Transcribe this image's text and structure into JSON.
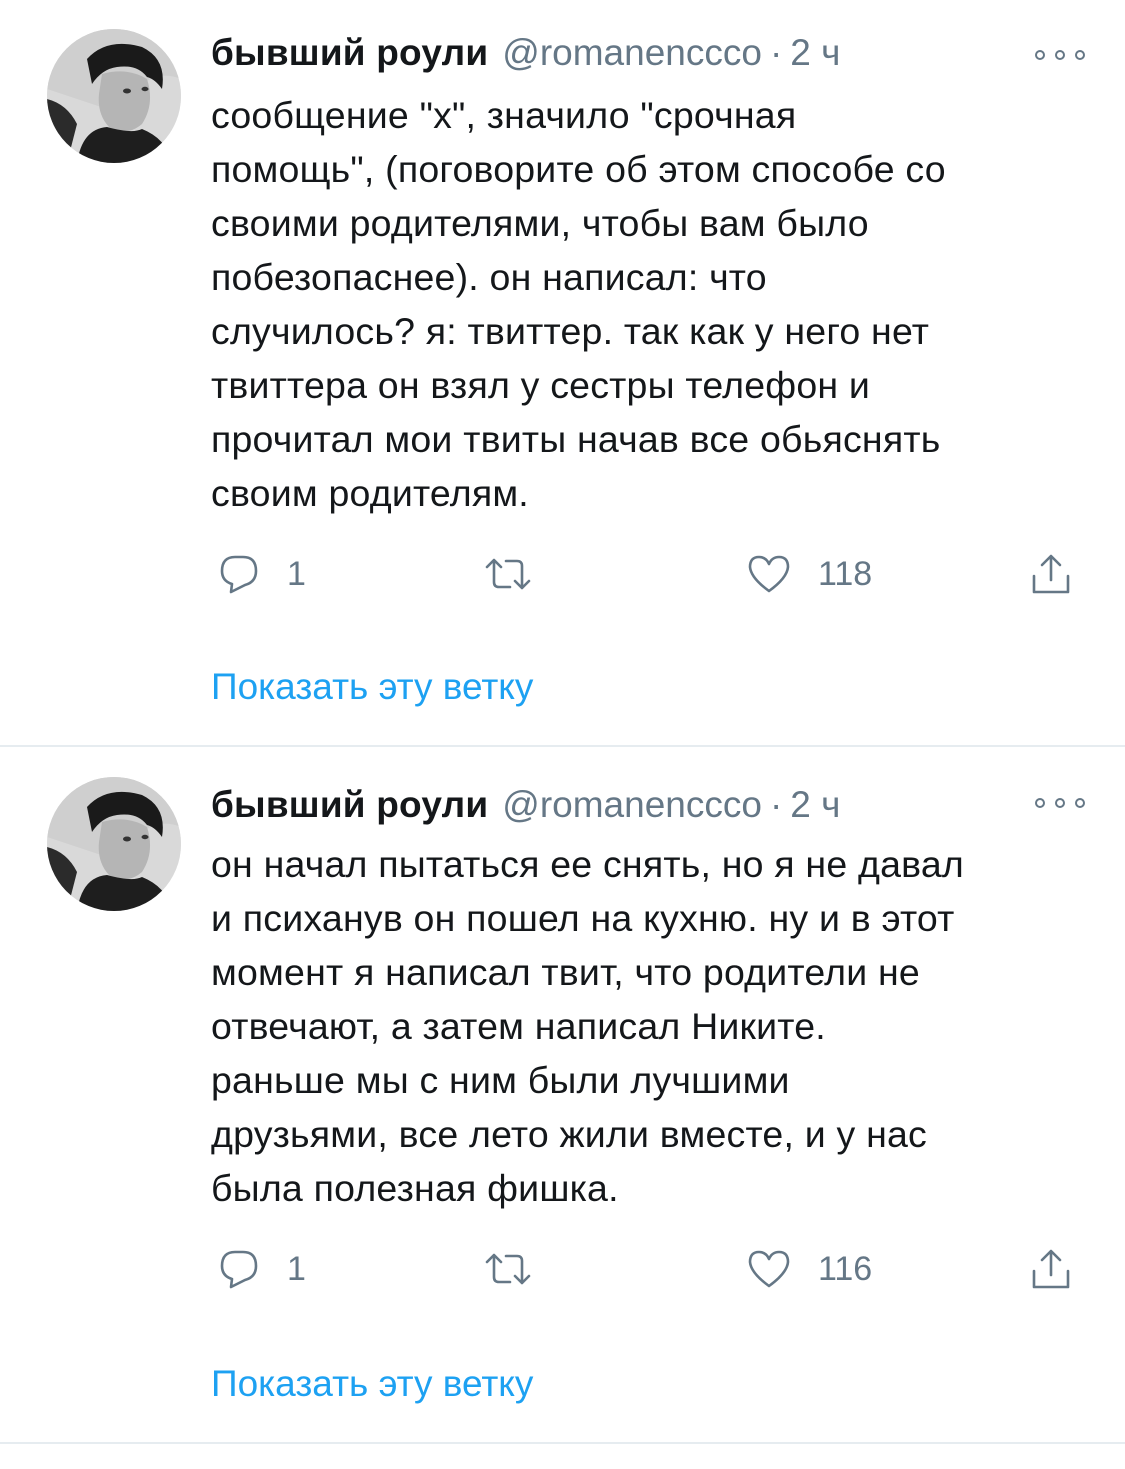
{
  "tweets": [
    {
      "display_name": "бывший роули",
      "handle": "@romanenccco",
      "separator": "·",
      "time": "2 ч",
      "lines": [
        "сообщение \"х\", значило \"срочная",
        "помощь\", (поговорите об этом способе со",
        "своими родителями, чтобы вам было",
        "побезопаснее). он написал: что",
        "случилось? я: твиттер. так как у него нет",
        "твиттера он взял у сестры телефон и",
        "прочитал мои твиты начав все обьяснять",
        "своим родителям."
      ],
      "replies": "1",
      "likes": "118",
      "show_thread": "Показать эту ветку"
    },
    {
      "display_name": "бывший роули",
      "handle": "@romanenccco",
      "separator": "·",
      "time": "2 ч",
      "lines": [
        "он начал пытаться ее снять, но я не давал",
        "и психанув он пошел на кухню. ну и в этот",
        "момент я написал твит, что родители не",
        "отвечают, а затем написал Никите.",
        "раньше мы с ним были лучшими",
        "друзьями, все лето жили вместе, и у нас",
        "была полезная фишка."
      ],
      "replies": "1",
      "likes": "116",
      "show_thread": "Показать эту ветку"
    }
  ],
  "icons": {
    "reply": "reply-icon",
    "retweet": "retweet-icon",
    "like": "heart-icon",
    "share": "share-icon",
    "more": "more-options-icon"
  },
  "colors": {
    "text": "#14171a",
    "secondary": "#657786",
    "link": "#1da1f2",
    "divider": "#e6ecf0"
  }
}
